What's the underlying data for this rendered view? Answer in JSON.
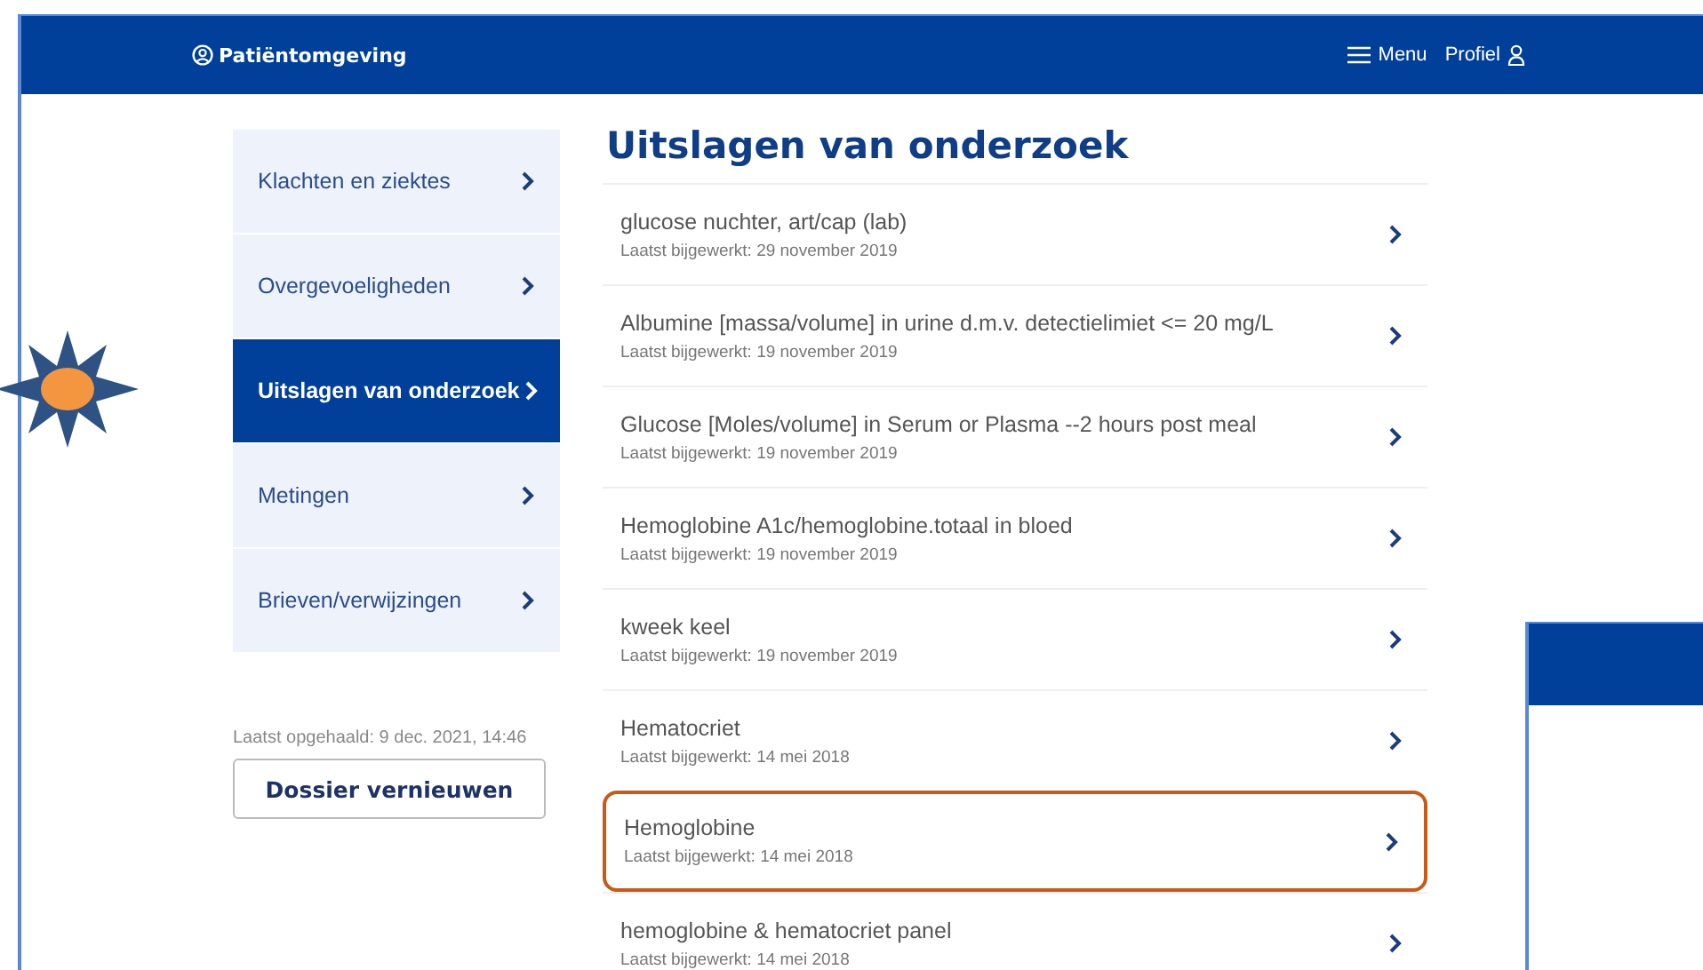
{
  "header": {
    "brand": "Patiëntomgeving",
    "menu": "Menu",
    "profile": "Profiel"
  },
  "sidebar": {
    "items": [
      {
        "label": "Klachten en ziektes",
        "selected": false
      },
      {
        "label": "Overgevoeligheden",
        "selected": false
      },
      {
        "label": "Uitslagen van onderzoek",
        "selected": true
      },
      {
        "label": "Metingen",
        "selected": false
      },
      {
        "label": "Brieven/verwijzingen",
        "selected": false
      }
    ],
    "last_fetched": "Laatst opgehaald: 9 dec. 2021, 14:46",
    "refresh_button": "Dossier vernieuwen"
  },
  "main": {
    "title": "Uitslagen van onderzoek",
    "results": [
      {
        "name": "glucose nuchter, art/cap (lab)",
        "updated": "Laatst bijgewerkt: 29 november 2019",
        "highlighted": false
      },
      {
        "name": "Albumine [massa/volume] in urine d.m.v. detectielimiet <= 20 mg/L",
        "updated": "Laatst bijgewerkt: 19 november 2019",
        "highlighted": false
      },
      {
        "name": "Glucose [Moles/volume] in Serum or Plasma --2 hours post meal",
        "updated": "Laatst bijgewerkt: 19 november 2019",
        "highlighted": false
      },
      {
        "name": "Hemoglobine A1c/hemoglobine.totaal in bloed",
        "updated": "Laatst bijgewerkt: 19 november 2019",
        "highlighted": false
      },
      {
        "name": "kweek keel",
        "updated": "Laatst bijgewerkt: 19 november 2019",
        "highlighted": false
      },
      {
        "name": "Hematocriet",
        "updated": "Laatst bijgewerkt: 14 mei 2018",
        "highlighted": false
      },
      {
        "name": "Hemoglobine",
        "updated": "Laatst bijgewerkt: 14 mei 2018",
        "highlighted": true
      },
      {
        "name": "hemoglobine & hematocriet panel",
        "updated": "Laatst bijgewerkt: 14 mei 2018",
        "highlighted": false
      }
    ]
  }
}
